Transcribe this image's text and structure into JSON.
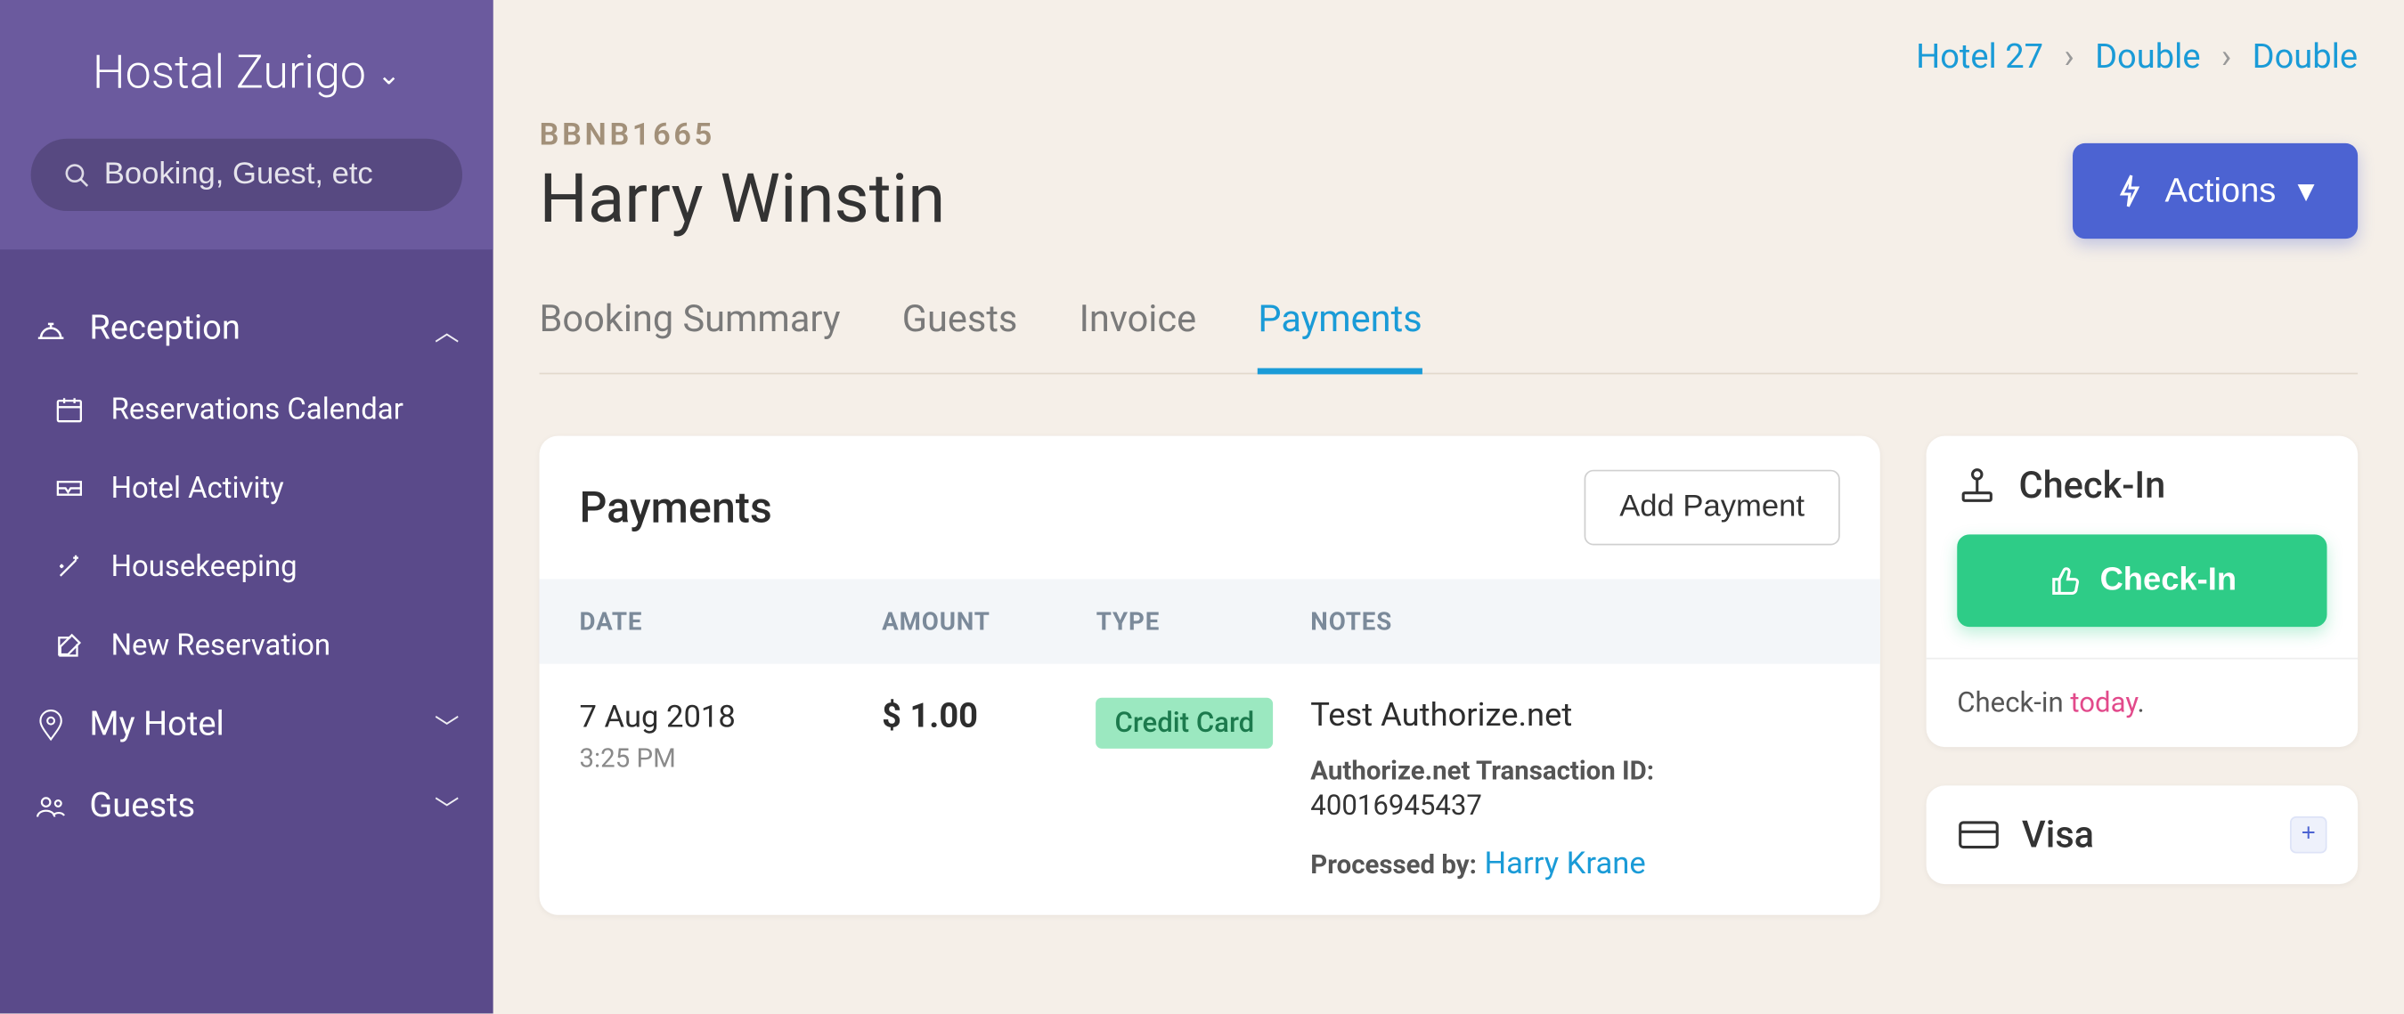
{
  "sidebar": {
    "hotel_name": "Hostal Zurigo",
    "search_placeholder": "Booking, Guest, etc",
    "groups": {
      "reception": {
        "label": "Reception"
      },
      "myhotel": {
        "label": "My Hotel"
      },
      "guests": {
        "label": "Guests"
      }
    },
    "reception_items": [
      {
        "label": "Reservations Calendar"
      },
      {
        "label": "Hotel Activity"
      },
      {
        "label": "Housekeeping"
      },
      {
        "label": "New Reservation"
      }
    ]
  },
  "breadcrumbs": {
    "hotel": "Hotel 27",
    "roomtype": "Double",
    "room": "Double"
  },
  "booking": {
    "code": "BBNB1665",
    "guest_name": "Harry Winstin"
  },
  "actions_label": "Actions",
  "tabs": {
    "summary": "Booking Summary",
    "guests": "Guests",
    "invoice": "Invoice",
    "payments": "Payments"
  },
  "payments_card": {
    "title": "Payments",
    "add_label": "Add Payment",
    "columns": {
      "date": "DATE",
      "amount": "AMOUNT",
      "type": "TYPE",
      "notes": "NOTES"
    },
    "row": {
      "date": "7 Aug 2018",
      "time": "3:25 PM",
      "amount": "$ 1.00",
      "type_badge": "Credit Card",
      "notes_main": "Test Authorize.net",
      "txn_label": "Authorize.net Transaction ID:",
      "txn_id": "40016945437",
      "proc_label": "Processed by:",
      "proc_name": "Harry Krane"
    }
  },
  "checkin_card": {
    "title": "Check-In",
    "button": "Check-In",
    "note_prefix": "Check-in ",
    "note_today": "today",
    "note_suffix": "."
  },
  "visa_card": {
    "title": "Visa"
  }
}
